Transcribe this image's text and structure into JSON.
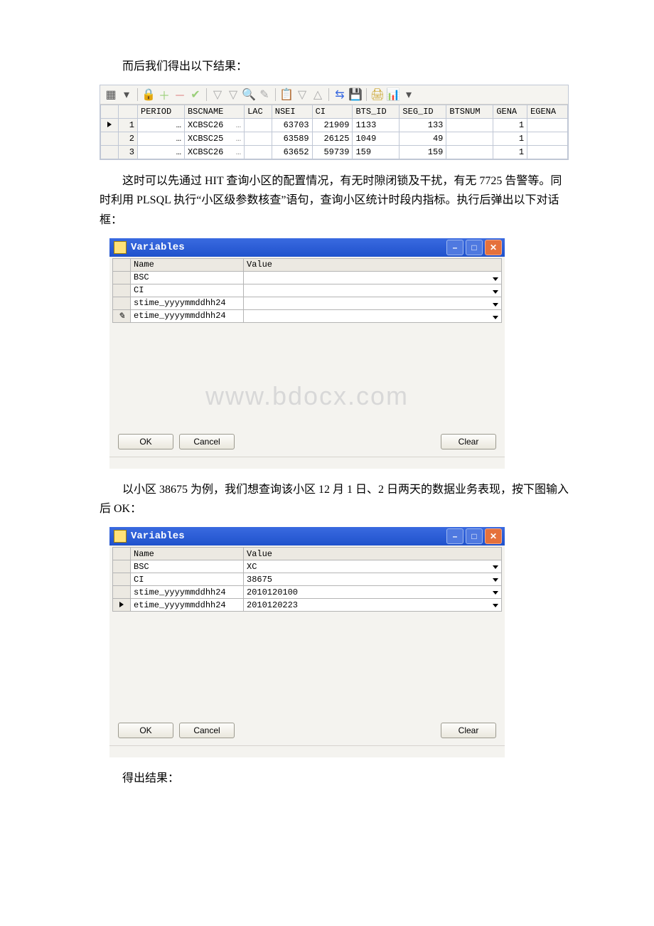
{
  "para1": "而后我们得出以下结果：",
  "resultTable": {
    "headers": [
      "",
      "",
      "PERIOD",
      "BSCNAME",
      "LAC",
      "NSEI",
      "CI",
      "BTS_ID",
      "SEG_ID",
      "BTSNUM",
      "GENA",
      "EGENA"
    ],
    "rows": [
      {
        "ind": "▶",
        "n": "1",
        "period": "…",
        "bsc": "XCBSC26",
        "bscx": "…",
        "lac": "",
        "nsei": "63703",
        "ci": "21909",
        "bts": "1133",
        "seg": "133",
        "btsnum": "",
        "gena": "1",
        "egena": ""
      },
      {
        "ind": "",
        "n": "2",
        "period": "…",
        "bsc": "XCBSC25",
        "bscx": "…",
        "lac": "",
        "nsei": "63589",
        "ci": "26125",
        "bts": "1049",
        "seg": "49",
        "btsnum": "",
        "gena": "1",
        "egena": ""
      },
      {
        "ind": "",
        "n": "3",
        "period": "…",
        "bsc": "XCBSC26",
        "bscx": "…",
        "lac": "",
        "nsei": "63652",
        "ci": "59739",
        "bts": "159",
        "seg": "159",
        "btsnum": "",
        "gena": "1",
        "egena": ""
      }
    ]
  },
  "para2": "这时可以先通过 HIT 查询小区的配置情况，有无时隙闭锁及干扰，有无 7725 告警等。同时利用 PLSQL 执行“小区级参数核查”语句，查询小区统计时段内指标。执行后弹出以下对话框：",
  "dlg1": {
    "title": "Variables",
    "cols": {
      "name": "Name",
      "value": "Value"
    },
    "rows": [
      {
        "ind": "",
        "name": "BSC",
        "value": ""
      },
      {
        "ind": "",
        "name": "CI",
        "value": ""
      },
      {
        "ind": "",
        "name": "stime_yyyymmddhh24",
        "value": ""
      },
      {
        "ind": "✎",
        "name": "etime_yyyymmddhh24",
        "value": ""
      }
    ],
    "buttons": {
      "ok": "OK",
      "cancel": "Cancel",
      "clear": "Clear"
    }
  },
  "watermark": "www.bdocx.com",
  "para3": "以小区 38675 为例，我们想查询该小区 12 月 1 日、2 日两天的数据业务表现，按下图输入后 OK：",
  "dlg2": {
    "title": "Variables",
    "cols": {
      "name": "Name",
      "value": "Value"
    },
    "rows": [
      {
        "ind": "",
        "name": "BSC",
        "value": "XC"
      },
      {
        "ind": "",
        "name": "CI",
        "value": "38675"
      },
      {
        "ind": "",
        "name": "stime_yyyymmddhh24",
        "value": "2010120100"
      },
      {
        "ind": "▶",
        "name": "etime_yyyymmddhh24",
        "value": "2010120223"
      }
    ],
    "buttons": {
      "ok": "OK",
      "cancel": "Cancel",
      "clear": "Clear"
    }
  },
  "para4": "得出结果："
}
